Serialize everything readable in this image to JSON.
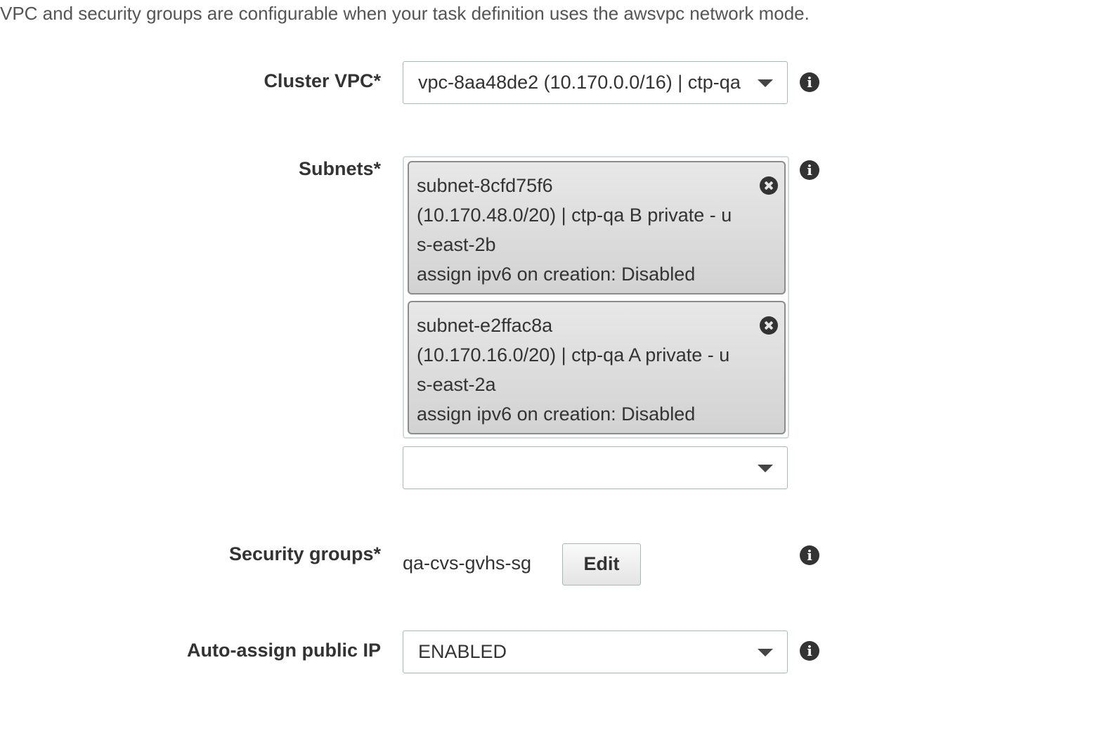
{
  "intro_text": "VPC and security groups are configurable when your task definition uses the awsvpc network mode.",
  "cluster_vpc": {
    "label": "Cluster VPC*",
    "selected_value": "vpc-8aa48de2 (10.170.0.0/16) | ctp-qa",
    "icon": "chevron-down-icon",
    "info_icon": "info-icon"
  },
  "subnets": {
    "label": "Subnets*",
    "selected": [
      {
        "lines": [
          "subnet-8cfd75f6",
          "(10.170.48.0/20) | ctp-qa B private - u",
          "s-east-2b",
          "assign ipv6 on creation: Disabled"
        ],
        "remove_icon": "close-circle-icon"
      },
      {
        "lines": [
          "subnet-e2ffac8a",
          "(10.170.16.0/20) | ctp-qa A private - u",
          "s-east-2a",
          "assign ipv6 on creation: Disabled"
        ],
        "remove_icon": "close-circle-icon"
      }
    ],
    "add_select_value": "",
    "info_icon": "info-icon"
  },
  "security_groups": {
    "label": "Security groups*",
    "value": "qa-cvs-gvhs-sg",
    "edit_label": "Edit",
    "info_icon": "info-icon"
  },
  "auto_assign_ip": {
    "label": "Auto-assign public IP",
    "selected_value": "ENABLED",
    "icon": "chevron-down-icon",
    "info_icon": "info-icon"
  },
  "colors": {
    "label_text": "#333333",
    "intro_text": "#555555",
    "chip_background": "#d9d9d9",
    "input_border": "#aab7b8"
  }
}
